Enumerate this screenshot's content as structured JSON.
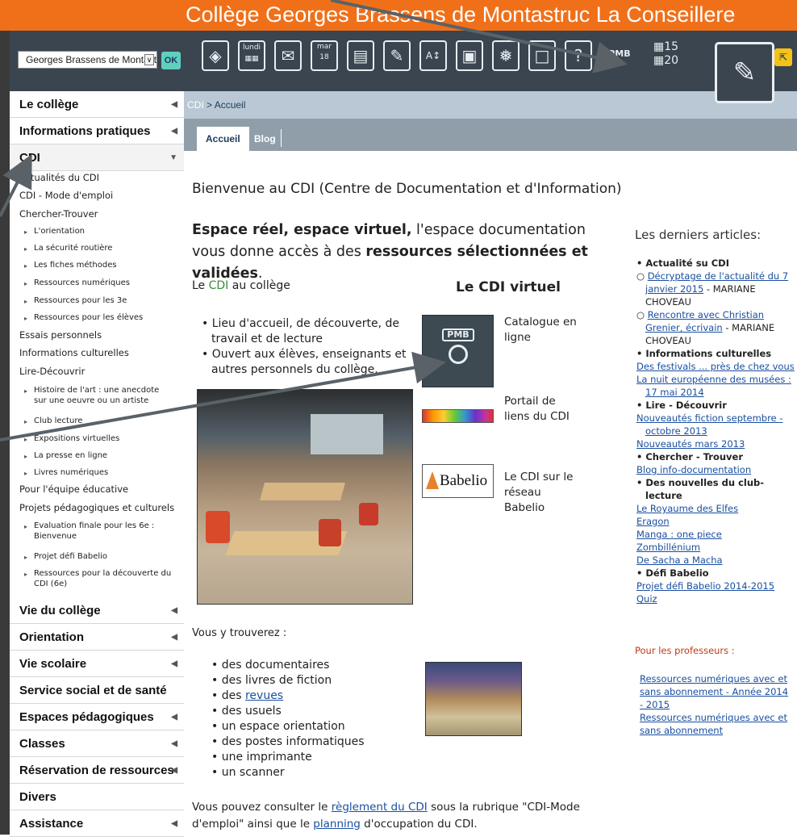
{
  "header": {
    "site_title": "Collège Georges Brassens de Montastruc La Conseillere",
    "colors": {
      "topbar": "#f0701a",
      "dark": "#3b4550",
      "accent": "#5fd0c0",
      "breadcrumb_bg": "#b9c8d4",
      "tab_bg": "#909eaa"
    }
  },
  "school_select": {
    "value": "Georges Brassens de Montastr",
    "ok_label": "OK"
  },
  "toolbar_icons": [
    "usb-key-icon",
    "calendar-week-icon",
    "mail-icon",
    "calendar-day-icon",
    "book-icon",
    "document-pen-icon",
    "dictionary-icon",
    "image-icon",
    "snowflake-icon",
    "profile-card-icon",
    "help-icon",
    "pmb-catalogue-icon",
    "timetable-icon",
    "edit-page-icon",
    "yellow-window-icon"
  ],
  "toolbar_text": {
    "cal_week": "lundi",
    "cal_day_month": "mar",
    "cal_day_num": "18",
    "timetable_a": "15",
    "timetable_b": "20"
  },
  "sidebar": {
    "top_items": [
      {
        "label": "Le collège"
      },
      {
        "label": "Informations pratiques"
      },
      {
        "label": "CDI"
      }
    ],
    "cdi_items": [
      {
        "label": "Actualités du CDI"
      },
      {
        "label": "CDI - Mode d'emploi"
      },
      {
        "label": "Chercher-Trouver"
      }
    ],
    "chercher_sub": [
      "L'orientation",
      "La sécurité routière",
      "Les fiches méthodes",
      "Ressources numériques",
      "Ressources pour les 3e",
      "Ressources pour les élèves"
    ],
    "cdi_items2": [
      {
        "label": "Essais personnels"
      },
      {
        "label": "Informations culturelles"
      },
      {
        "label": "Lire-Découvrir"
      }
    ],
    "lire_sub": [
      "Histoire de l'art : une anecdote sur une oeuvre ou un artiste",
      "Club lecture",
      "Expositions virtuelles",
      "La presse en ligne",
      "Livres numériques"
    ],
    "cdi_items3": [
      {
        "label": "Pour l'équipe éducative"
      },
      {
        "label": "Projets pédagogiques et culturels"
      }
    ],
    "projets_sub": [
      "Evaluation finale pour les 6e : Bienvenue",
      "Projet défi Babelio",
      "Ressources pour la découverte du CDI (6e)"
    ],
    "bottom_items": [
      {
        "label": "Vie du collège"
      },
      {
        "label": "Orientation"
      },
      {
        "label": "Vie scolaire"
      },
      {
        "label": "Service social et de santé"
      },
      {
        "label": "Espaces pédagogiques"
      },
      {
        "label": "Classes"
      },
      {
        "label": "Réservation de ressources"
      },
      {
        "label": "Divers"
      },
      {
        "label": "Assistance"
      }
    ]
  },
  "breadcrumb": {
    "root": "CDI",
    "sep": " > ",
    "current": "Accueil"
  },
  "tabs": {
    "accueil": "Accueil",
    "blog": "Blog"
  },
  "main": {
    "welcome": "Bienvenue au CDI (Centre de Documentation et d'Information)",
    "intro_b1": "Espace réel, espace virtuel,",
    "intro_t1": " l'espace documentation vous donne accès à des ",
    "intro_b2": "ressources sélectionnées et validées",
    "intro_t2": ".",
    "lecdi_pre": "Le ",
    "lecdi_link": "CDI",
    "lecdi_post": " au collège",
    "cdi_virtuel": "Le CDI virtuel",
    "bullet1": "Lieu d'accueil, de découverte, de travail et de lecture",
    "bullet2": "Ouvert aux élèves, enseignants et autres personnels du collège.",
    "pmb_text": "PMB",
    "catalogue": "Catalogue en ligne",
    "portail": "Portail de liens du CDI",
    "babelio_logo": "Babelio",
    "babelio_text": "Le CDI sur le réseau Babelio",
    "vous_trouverez": "Vous y trouverez :",
    "list": [
      "des documentaires",
      "des livres de fiction",
      "des ",
      "des usuels",
      "un espace orientation",
      "des postes informatiques",
      "une imprimante",
      "un scanner"
    ],
    "revues_link": "revues",
    "reg_t1": "Vous pouvez consulter le ",
    "reg_l1": "règlement du CDI",
    "reg_t2": " sous la rubrique \"CDI-Mode d'emploi\" ainsi que le ",
    "reg_l2": "planning",
    "reg_t3": " d'occupation du CDI."
  },
  "articles": {
    "title": "Les derniers articles:",
    "actualite": "Actualité su CDI",
    "a1_link": "Décryptage de l'actualité du 7 janvier 2015",
    "a1_author": " - MARIANE CHOVEAU",
    "a2_link": "Rencontre avec Christian Grenier, écrivain",
    "a2_author": " - MARIANE CHOVEAU",
    "info_cult": "Informations culturelles",
    "ic1": "Des festivals ... près de chez vous",
    "ic2": "La nuit européenne des musées : 17 mai 2014",
    "lire": "Lire - Découvrir",
    "l1": "Nouveautés fiction septembre - octobre 2013",
    "l2": "Nouveautés mars 2013",
    "chercher": "Chercher - Trouver",
    "c1": "Blog info-documentation",
    "club": "Des nouvelles du club-lecture",
    "club_links": [
      "Le Royaume des Elfes",
      "Eragon",
      "Manga : one piece",
      "Zombillénium",
      "De Sacha a Macha"
    ],
    "defi": "Défi Babelio",
    "d1": "Projet défi Babelio 2014-2015",
    "d2": "Quiz"
  },
  "prof": {
    "title": "Pour les professeurs :",
    "link1": "Ressources numériques avec et sans abonnement - Année 2014 - 2015",
    "link2": "Ressources numériques avec et sans abonnement"
  }
}
